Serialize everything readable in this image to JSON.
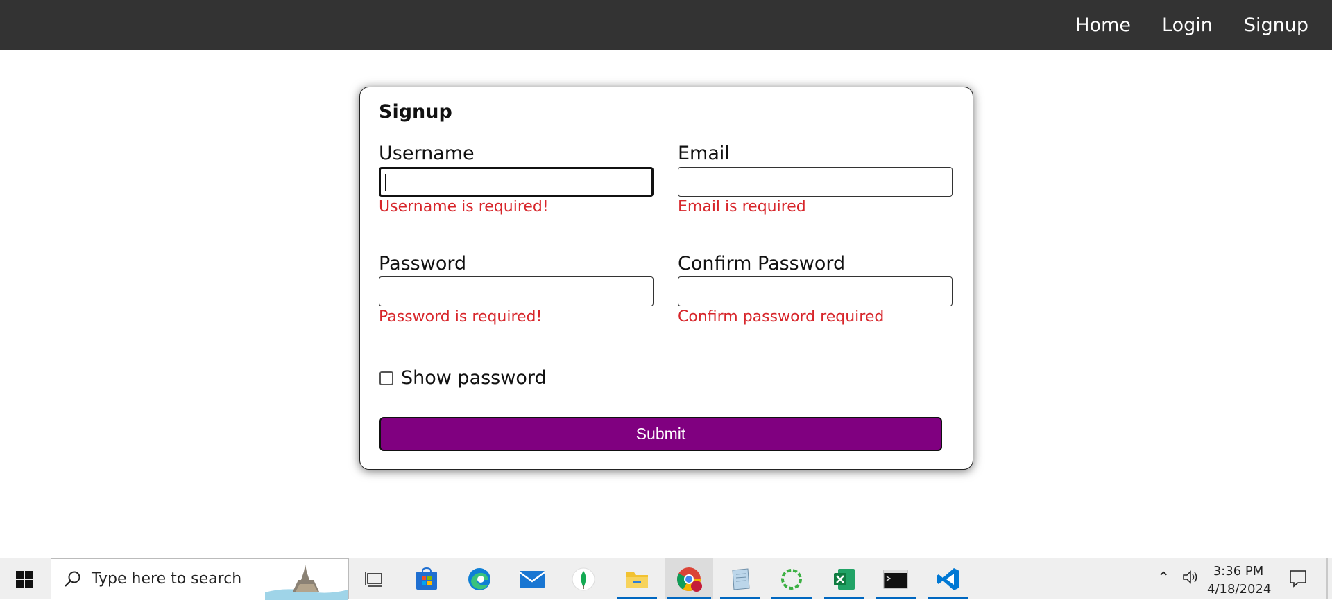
{
  "nav": {
    "links": [
      "Home",
      "Login",
      "Signup"
    ]
  },
  "form": {
    "title": "Signup",
    "fields": {
      "username": {
        "label": "Username",
        "value": "",
        "error": "Username is required!"
      },
      "email": {
        "label": "Email",
        "value": "",
        "error": "Email is required"
      },
      "password": {
        "label": "Password",
        "value": "",
        "error": "Password is required!"
      },
      "confirm_password": {
        "label": "Confirm Password",
        "value": "",
        "error": "Confirm password required"
      }
    },
    "show_password_label": "Show password",
    "show_password_checked": false,
    "submit_label": "Submit"
  },
  "colors": {
    "navbar_bg": "#333333",
    "error": "#d7262b",
    "submit_bg": "#800080"
  },
  "taskbar": {
    "search_placeholder": "Type here to search",
    "apps": [
      "task-view-icon",
      "microsoft-store-icon",
      "edge-icon",
      "mail-icon",
      "mongodb-compass-icon",
      "file-explorer-icon",
      "chrome-icon",
      "notepad-icon",
      "refresh-app-icon",
      "excel-icon",
      "terminal-icon",
      "vscode-icon"
    ],
    "time": "3:36 PM",
    "date": "4/18/2024"
  }
}
